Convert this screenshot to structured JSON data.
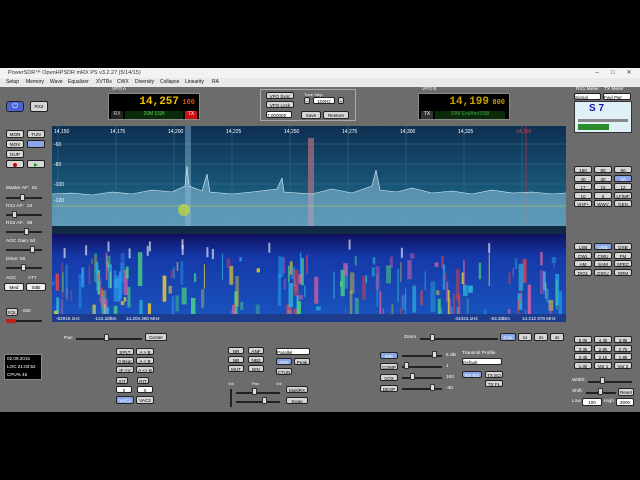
{
  "window": {
    "title": "PowerSDR™ OpenHPSDR mRX PS v3.2.27 (5/14/15)",
    "minimize": "–",
    "maximize": "□",
    "close": "✕"
  },
  "menu": [
    "Setup",
    "Memory",
    "Wave",
    "Equalizer",
    "XVTRs",
    "CWX",
    "Diversity",
    "Collapse",
    "Linearity",
    "RA"
  ],
  "left_panel": {
    "power_label": "⏻",
    "rx2_label": "RX2",
    "mon": "MON",
    "tun": "TUN",
    "mox": "MOX",
    "dup": "DUP",
    "master_af_label": "Master AF:",
    "master_af_value": "51",
    "rx1_af_label": "RX1 AF:",
    "rx1_af_value": "24",
    "rx2_af_label": "RX2 AF:",
    "rx2_af_value": "58",
    "agc_gain_label": "AGC Gain:",
    "agc_gain_value": "92",
    "drive_label": "Drive:",
    "drive_value": "50",
    "agc_label": "AGC",
    "att_label": "ATT",
    "agc_mode": "Med",
    "att_value": "0dB",
    "sql_label": "SQL",
    "sql_value": "-150"
  },
  "vfo_a": {
    "label": "VFO A",
    "freq_main": "14,257",
    "freq_sub": "100",
    "mode": "20M SSB",
    "rx": "RX",
    "tx": "TX"
  },
  "vfo_center": {
    "vfo_sync": "VFO Sync",
    "vfo_lock": "VFO Lock",
    "tune_step_label": "Tune\nStep:",
    "tune_step_value": "100Hz",
    "minus": "−",
    "plus": "+",
    "offset": "7.000000",
    "save": "Save",
    "restore": "Restore"
  },
  "vfo_b": {
    "label": "VFO B",
    "freq_main": "14,199",
    "freq_sub": "800",
    "mode": "20M Ext/Am/SSB",
    "tx": "TX"
  },
  "meter": {
    "rx1_meter": "RX1 Meter",
    "tx_meter": "TX Meter",
    "signal": "Signal",
    "fwd_pwr": "Fwd Pwr",
    "reading": "S 7"
  },
  "panadapter": {
    "freq_ticks": [
      "14,150",
      "14,175",
      "14,200",
      "14,225",
      "14,250",
      "14,275",
      "14,300",
      "14,325",
      "14,350"
    ],
    "db_ticks": [
      "-60",
      "-80",
      "-100",
      "-120"
    ],
    "zoom_label": "Zoom",
    "pan_label": "Pan",
    "center": "Center",
    "readout_left": "-52919.1Hz",
    "readout_mid1": "-143.3dBm",
    "readout_mid2": "14.204.260 MHz",
    "readout_right1": "-44424.1Hz",
    "readout_right2": "-93.3dBm",
    "readout_right3": "14.212 678 MHz",
    "zoom_buttons": [
      "0.5x",
      "1x",
      "2x",
      "4x"
    ]
  },
  "bands": [
    "160",
    "80",
    "60",
    "40",
    "30",
    "20",
    "17",
    "15",
    "12",
    "10",
    "6",
    "LF/MF",
    "VHF+",
    "WWV",
    "GEN"
  ],
  "modes": [
    "LSB",
    "USB",
    "DSB",
    "CWL",
    "CWU",
    "FM",
    "AM",
    "SAM",
    "SPEC",
    "DIGL",
    "DIGU",
    "DRM"
  ],
  "filters": [
    "5.0k",
    "4.4k",
    "3.8k",
    "3.3k",
    "2.9k",
    "2.7k",
    "2.4k",
    "2.1k",
    "1.8k",
    "1.0k",
    "Var 1",
    "Var 2"
  ],
  "filter_labels": {
    "width": "Width:",
    "shift": "Shift:",
    "low": "Low",
    "high": "High",
    "reset": "Reset",
    "low_value": "100",
    "high_value": "2900"
  },
  "bottom": {
    "date": "02.09.2015",
    "loc": "LOC 21:03:52",
    "cpu": "CPU% 46",
    "split": "SPLT",
    "a_to_b": "A > B",
    "zero_beat": "0 Beat",
    "b_to_a": "A < B",
    "if_vfo": "IF->V",
    "swap": "A <> B",
    "xit": "XIT",
    "rit": "RIT",
    "xit_value": "0",
    "rit_value": "0",
    "vac1": "VAC1",
    "vac2": "VAC2",
    "nr": "NR",
    "anf": "ANF",
    "nb": "NB",
    "nb2": "NB2",
    "mut": "MUT",
    "bin": "BIN",
    "parallel": "Parallel",
    "avg": "AVG",
    "peak": "Peak",
    "ctun": "CTUN",
    "vol_label": "Vol",
    "pan_label": "Pan",
    "vol2_label": "Vol",
    "multirx": "MultiRX",
    "swap_btn": "Swap",
    "mic": "MIC",
    "mic_value": "6 dB",
    "comp": "COMP",
    "comp_value": "1",
    "vox": "VOX",
    "vox_value": "100",
    "dexp": "DEXP",
    "dexp_value": "-40",
    "transmit_profile_label": "Transmit Profile",
    "transmit_profile": "Default",
    "rx_eq": "RX EQ",
    "tx_eq": "TX EQ",
    "tx_fl": "TX FL"
  },
  "colors": {
    "accent_blue": "#4a64d8",
    "freq_yellow": "#f2c000",
    "mode_green": "#4fd84f",
    "tx_red": "#cc1111"
  }
}
